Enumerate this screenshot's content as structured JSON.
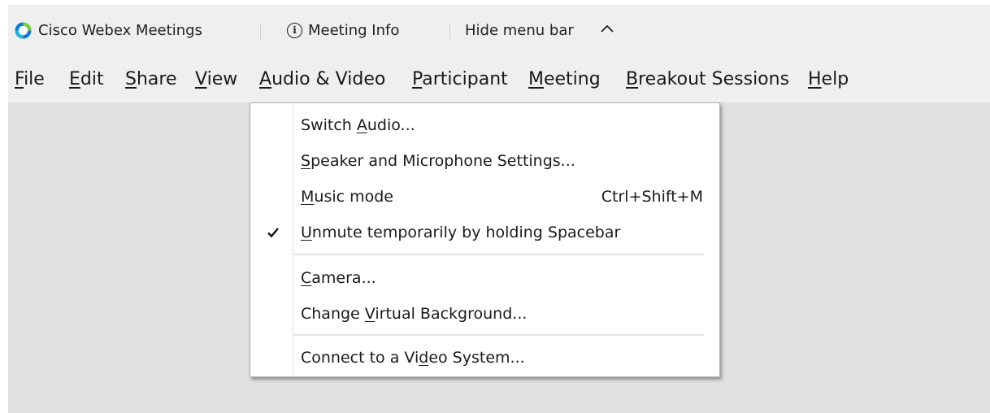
{
  "titlebar": {
    "app_name": "Cisco Webex Meetings",
    "meeting_info": "Meeting Info",
    "hide_menu_bar": "Hide menu bar"
  },
  "menubar": [
    {
      "pre": "",
      "u": "F",
      "post": "ile"
    },
    {
      "pre": "",
      "u": "E",
      "post": "dit"
    },
    {
      "pre": "",
      "u": "S",
      "post": "hare"
    },
    {
      "pre": "",
      "u": "V",
      "post": "iew"
    },
    {
      "pre": "",
      "u": "A",
      "post": "udio & Video"
    },
    {
      "pre": "",
      "u": "P",
      "post": "articipant"
    },
    {
      "pre": "",
      "u": "M",
      "post": "eeting"
    },
    {
      "pre": "",
      "u": "B",
      "post": "reakout Sessions"
    },
    {
      "pre": "",
      "u": "H",
      "post": "elp"
    }
  ],
  "dropdown": {
    "items": [
      {
        "pre": "Switch ",
        "u": "A",
        "post": "udio...",
        "shortcut": "",
        "checked": false
      },
      {
        "pre": "",
        "u": "S",
        "post": "peaker and Microphone Settings...",
        "shortcut": "",
        "checked": false
      },
      {
        "pre": "",
        "u": "M",
        "post": "usic mode",
        "shortcut": "Ctrl+Shift+M",
        "checked": false
      },
      {
        "pre": "",
        "u": "U",
        "post": "nmute temporarily by holding Spacebar",
        "shortcut": "",
        "checked": true
      },
      {
        "pre": "",
        "u": "C",
        "post": "amera...",
        "shortcut": "",
        "checked": false
      },
      {
        "pre": "Change ",
        "u": "V",
        "post": "irtual Background...",
        "shortcut": "",
        "checked": false
      },
      {
        "pre": "Connect to a Vi",
        "u": "d",
        "post": "eo System...",
        "shortcut": "",
        "checked": false
      }
    ]
  },
  "colors": {
    "app_background": "#e0e0e0",
    "bar_background": "#efefef",
    "menu_background": "#ffffff",
    "logo_blue": "#0a7ad8",
    "logo_green": "#7bd12f"
  }
}
